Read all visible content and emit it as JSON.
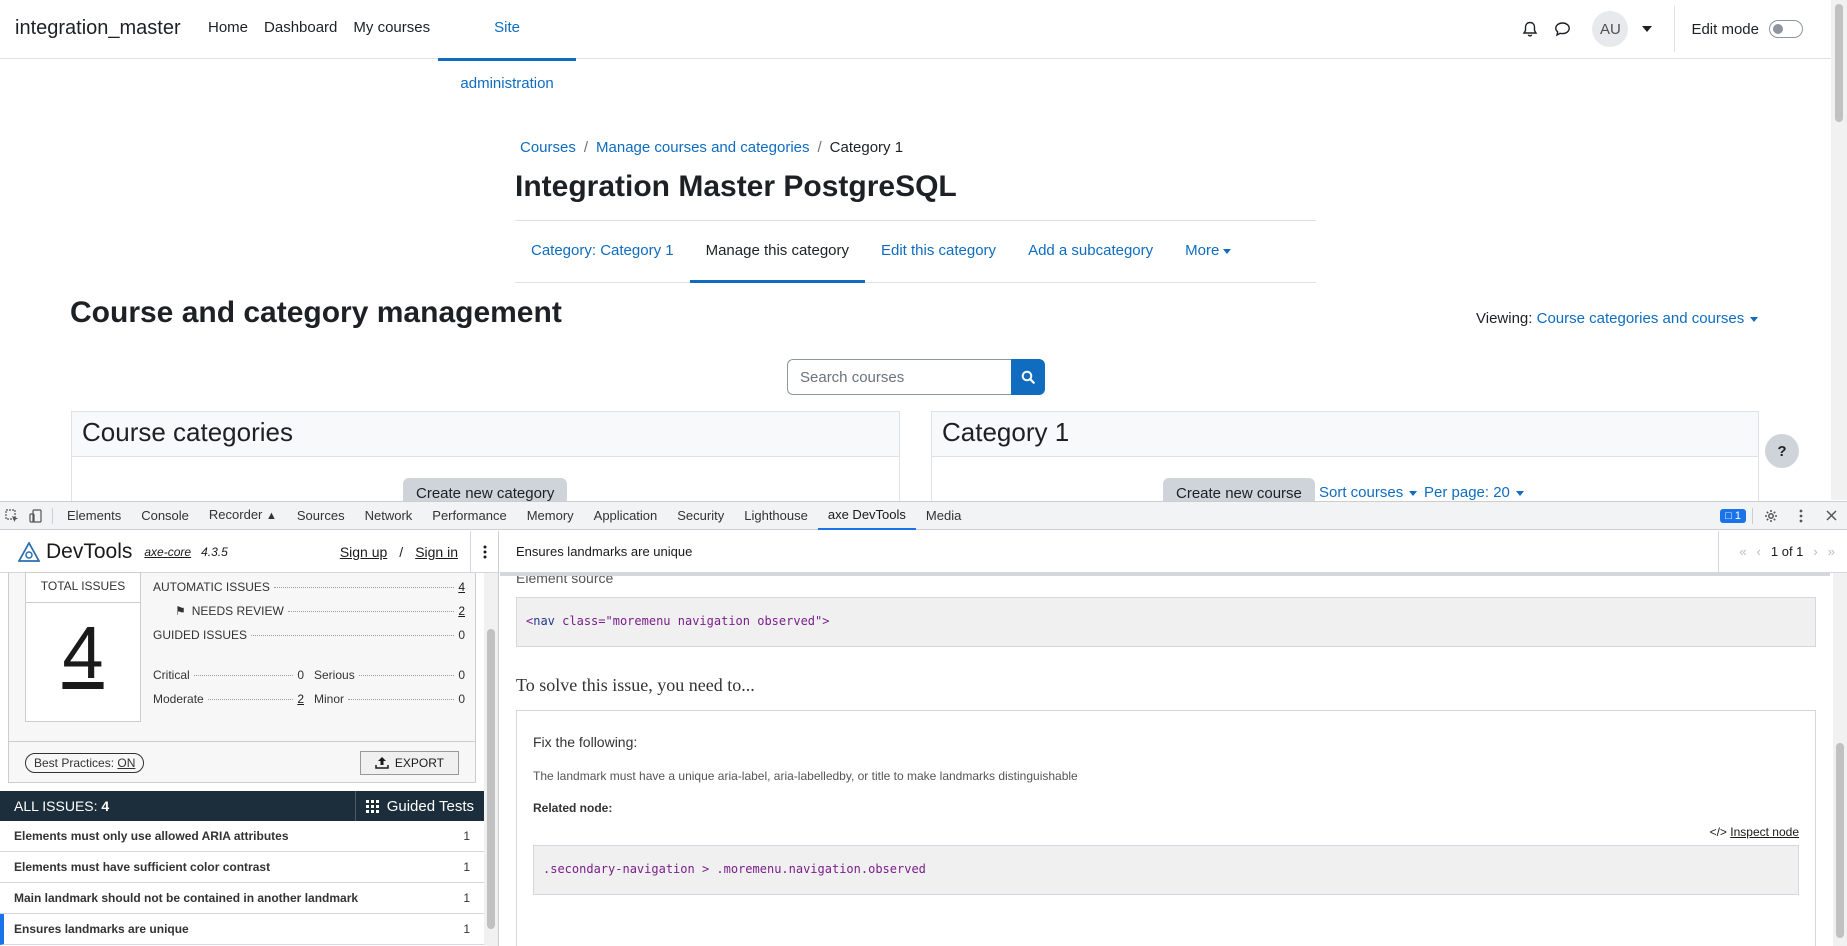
{
  "navbar": {
    "brand": "integration_master",
    "items": [
      {
        "label": "Home"
      },
      {
        "label": "Dashboard"
      },
      {
        "label": "My courses"
      },
      {
        "label": "Site administration"
      }
    ],
    "avatar_initials": "AU",
    "edit_mode_label": "Edit mode",
    "edit_mode_on": false
  },
  "breadcrumb": {
    "items": [
      "Courses",
      "Manage courses and categories",
      "Category 1"
    ],
    "separator": "/"
  },
  "page_title": "Integration Master PostgreSQL",
  "secondary_nav": {
    "tabs": [
      {
        "label": "Category: Category 1"
      },
      {
        "label": "Manage this category"
      },
      {
        "label": "Edit this category"
      },
      {
        "label": "Add a subcategory"
      },
      {
        "label": "More"
      }
    ],
    "active": "Manage this category"
  },
  "management": {
    "heading": "Course and category management",
    "viewing_label": "Viewing:",
    "viewing_value": "Course categories and courses",
    "search_placeholder": "Search courses"
  },
  "categories_card": {
    "title": "Course categories",
    "create_button": "Create new category"
  },
  "category_card": {
    "title": "Category 1",
    "create_button": "Create new course",
    "sort_link": "Sort courses",
    "per_page_link": "Per page: 20"
  },
  "help_button": "?",
  "devtools": {
    "tabs": [
      "Elements",
      "Console",
      "Recorder",
      "Sources",
      "Network",
      "Performance",
      "Memory",
      "Application",
      "Security",
      "Lighthouse",
      "axe DevTools",
      "Media"
    ],
    "active_tab": "axe DevTools",
    "message_count": "1"
  },
  "axe": {
    "brand": "DevTools",
    "core_label": "axe-core",
    "core_version": "4.3.5",
    "sign_up": "Sign up",
    "auth_sep": "/",
    "sign_in": "Sign in",
    "total_issues_label": "TOTAL ISSUES",
    "total_issues": "4",
    "automatic_label": "AUTOMATIC ISSUES",
    "automatic": "4",
    "needs_review_label": "NEEDS REVIEW",
    "needs_review": "2",
    "guided_label": "GUIDED ISSUES",
    "guided": "0",
    "critical_label": "Critical",
    "critical": "0",
    "serious_label": "Serious",
    "serious": "0",
    "moderate_label": "Moderate",
    "moderate": "2",
    "minor_label": "Minor",
    "minor": "0",
    "best_practices_label": "Best Practices:",
    "best_practices_value": "ON",
    "export_label": "EXPORT",
    "all_issues_label": "ALL ISSUES:",
    "all_issues_count": "4",
    "guided_tests_label": "Guided Tests",
    "issues": [
      {
        "title": "Elements must only use allowed ARIA attributes",
        "count": "1"
      },
      {
        "title": "Elements must have sufficient color contrast",
        "count": "1"
      },
      {
        "title": "Main landmark should not be contained in another landmark",
        "count": "1"
      },
      {
        "title": "Ensures landmarks are unique",
        "count": "1"
      }
    ],
    "detail": {
      "title": "Ensures landmarks are unique",
      "pager": "1 of 1",
      "section_cut_label": "Element source",
      "source_tag_open": "<nav ",
      "source_attr": "class=\"moremenu navigation observed\">",
      "solve_heading": "To solve this issue, you need to...",
      "fix_title": "Fix the following:",
      "fix_message": "The landmark must have a unique aria-label, aria-labelledby, or title to make landmarks distinguishable",
      "related_node_label": "Related node:",
      "inspect_node_label": "Inspect node",
      "selector": ".secondary-navigation > .moremenu.navigation.observed"
    }
  }
}
